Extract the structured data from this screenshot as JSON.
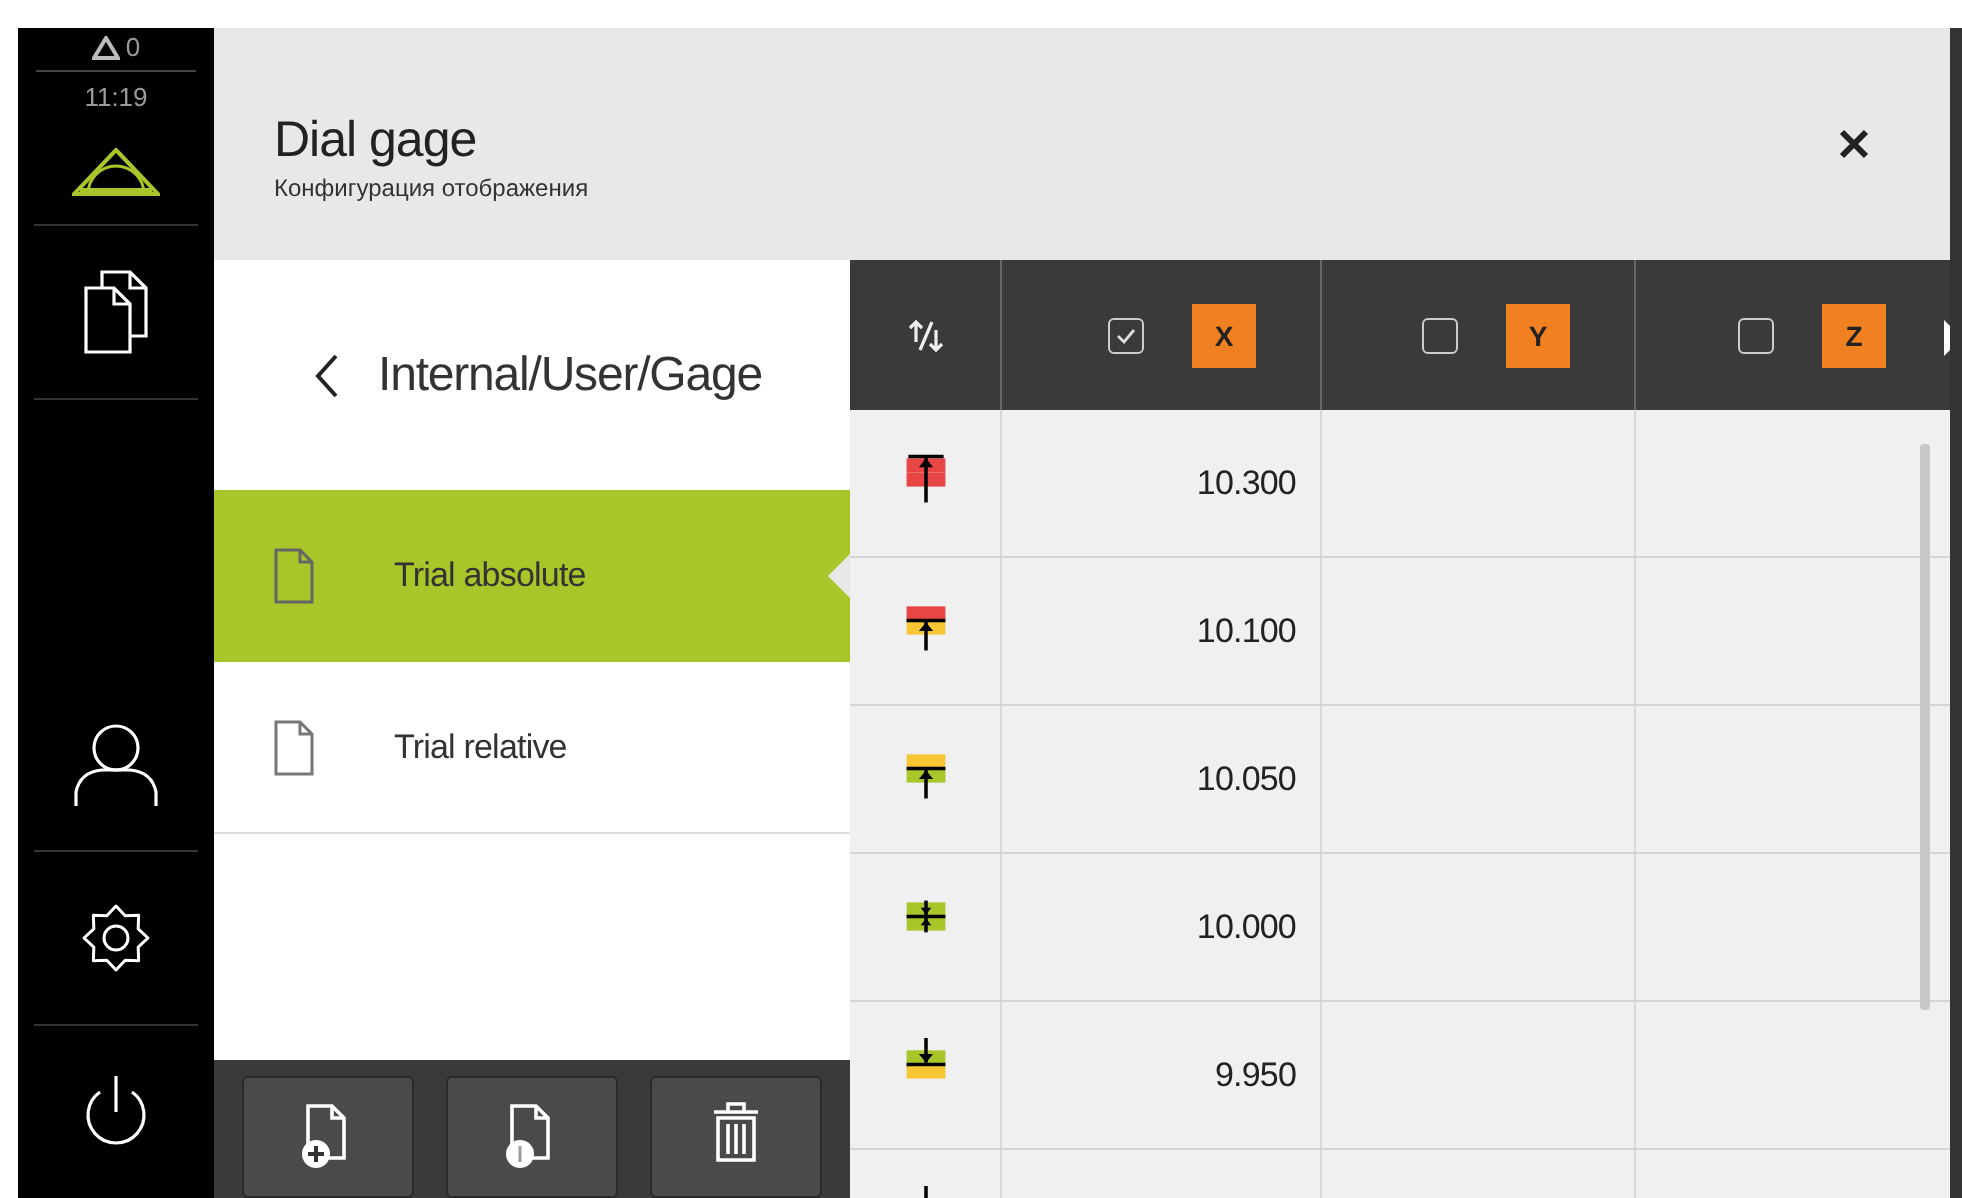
{
  "status": {
    "warnings": "0",
    "time": "11:19"
  },
  "sidebar": {
    "items": [
      {
        "kind": "files"
      },
      {
        "kind": "user"
      },
      {
        "kind": "settings"
      },
      {
        "kind": "power"
      }
    ]
  },
  "header": {
    "title": "Dial gage",
    "subtitle": "Конфигурация отображения"
  },
  "folder": {
    "path": "Internal/User/Gage"
  },
  "files": [
    {
      "name": "Trial absolute",
      "selected": true
    },
    {
      "name": "Trial relative",
      "selected": false
    }
  ],
  "toolbar": [
    {
      "kind": "add"
    },
    {
      "kind": "import"
    },
    {
      "kind": "delete"
    }
  ],
  "table": {
    "columns": [
      {
        "axis": "X",
        "checked": true
      },
      {
        "axis": "Y",
        "checked": false
      },
      {
        "axis": "Z",
        "checked": false
      }
    ],
    "rows": [
      {
        "kind": "overlimit",
        "value": "10.300"
      },
      {
        "kind": "warnhigh",
        "value": "10.100"
      },
      {
        "kind": "nearhigh",
        "value": "10.050"
      },
      {
        "kind": "nominal",
        "value": "10.000"
      },
      {
        "kind": "nearlow",
        "value": "9.950"
      },
      {
        "kind": "underlimit"
      }
    ]
  }
}
